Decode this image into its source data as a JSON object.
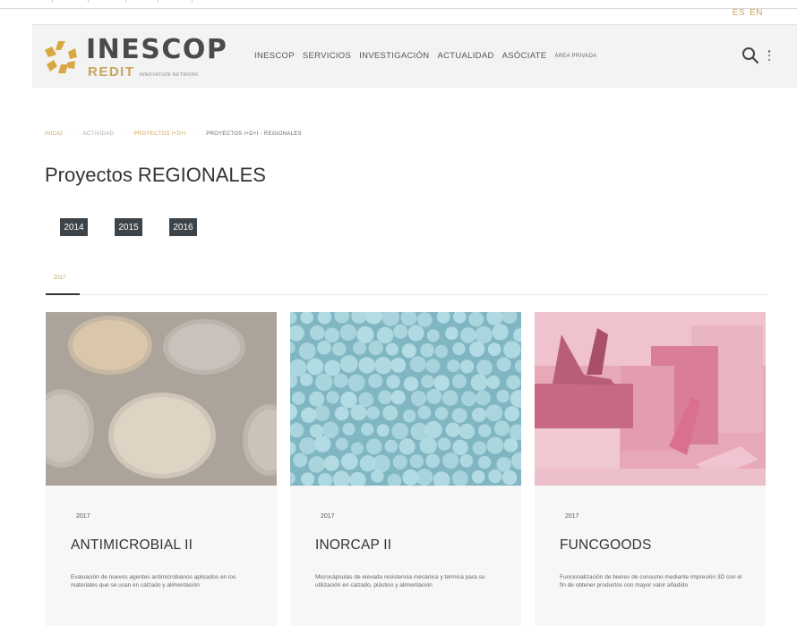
{
  "lang": {
    "es": "ES",
    "en": "EN"
  },
  "logo": {
    "title": "INESCOP",
    "sub": "REDIT",
    "network": "INNOVATION NETWORK"
  },
  "nav": {
    "items": [
      "INESCOP",
      "SERVICIOS",
      "INVESTIGACIÓN",
      "ACTUALIDAD",
      "ASÓCIATE"
    ],
    "private": "ÁREA PRIVADA"
  },
  "icons": {
    "search": "search-icon",
    "more": "more-vertical-icon"
  },
  "breadcrumb": [
    "INICIO",
    "ACTIVIDAD",
    "PROYECTOS I+D+I",
    "PROYECTOS I+D+I - REGIONALES"
  ],
  "page_title": "Proyectos REGIONALES",
  "years": [
    "2014",
    "2015",
    "2016"
  ],
  "active_tab": "2017",
  "colors": {
    "accent": "#c9a45b",
    "dark_button": "#3d4449",
    "card_body": "#f7f7f7"
  },
  "cards": [
    {
      "year": "2017",
      "title": "ANTIMICROBIAL II",
      "description": "Evaluación de nuevos agentes antimicrobianos aplicados en los materiales que se usan en calzado y alimentación"
    },
    {
      "year": "2017",
      "title": "INORCAP II",
      "description": "Microcápsulas de elevada resistencia mecánica y térmica para su utilización en calzado, plástico y alimentación"
    },
    {
      "year": "2017",
      "title": "FUNCGOODS",
      "description": "Funcionalización de bienes de consumo mediante impresión 3D con el fin de obtener productos con mayor valor añadido"
    }
  ]
}
